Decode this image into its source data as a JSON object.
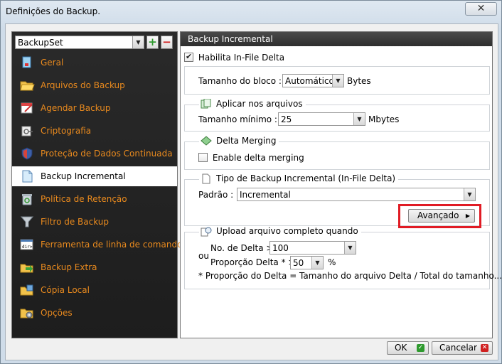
{
  "window": {
    "title": "Definições do Backup.",
    "close_glyph": "✕"
  },
  "sidebar": {
    "backupset": {
      "value": "BackupSet"
    },
    "add_glyph": "+",
    "remove_glyph": "−",
    "items": [
      {
        "label": "Geral",
        "icon": "general-icon"
      },
      {
        "label": "Arquivos do Backup",
        "icon": "folder-open-icon"
      },
      {
        "label": "Agendar Backup",
        "icon": "calendar-icon"
      },
      {
        "label": "Criptografia",
        "icon": "lock-key-icon"
      },
      {
        "label": "Proteção de Dados Continuada",
        "icon": "shield-icon"
      },
      {
        "label": "Backup Incremental",
        "icon": "document-icon"
      },
      {
        "label": "Política de Retenção",
        "icon": "recycle-bin-icon"
      },
      {
        "label": "Filtro de Backup",
        "icon": "funnel-icon"
      },
      {
        "label": "Ferramenta de linha de comando",
        "icon": "command-line-icon"
      },
      {
        "label": "Backup Extra",
        "icon": "folders-arrow-icon"
      },
      {
        "label": "Cópia Local",
        "icon": "local-copy-icon"
      },
      {
        "label": "Opções",
        "icon": "options-gear-icon"
      }
    ],
    "active_index": 5
  },
  "panel": {
    "header": "Backup Incremental",
    "in_file_delta": {
      "label": "Habilita In-File Delta",
      "checked": true
    },
    "block_size": {
      "label": "Tamanho do bloco :",
      "value": "Automático",
      "unit": "Bytes"
    },
    "apply_files": {
      "legend": "Aplicar nos arquivos",
      "min_label": "Tamanho mínimo :",
      "min_value": "25",
      "unit": "Mbytes"
    },
    "delta_merging": {
      "legend": "Delta Merging",
      "enable_label": "Enable delta merging",
      "checked": false
    },
    "incremental_type": {
      "legend": "Tipo de Backup Incremental (In-File Delta)",
      "default_label": "Padrão :",
      "value": "Incremental",
      "advanced_label": "Avançado"
    },
    "upload_full": {
      "legend": "Upload arquivo completo quando",
      "or_label": "ou",
      "delta_count_label": "No. de Delta >",
      "delta_count_value": "100",
      "delta_ratio_label": "Proporção Delta * >",
      "delta_ratio_value": "50",
      "percent": "%",
      "footnote": "* Proporção do Delta  = Tamanho do arquivo Delta / Total do tamanho..."
    }
  },
  "footer": {
    "ok_label": "OK",
    "cancel_label": "Cancelar"
  },
  "colors": {
    "nav_text": "#e98a1e",
    "sidebar_bg": "#222222",
    "highlight": "#e01b24"
  }
}
